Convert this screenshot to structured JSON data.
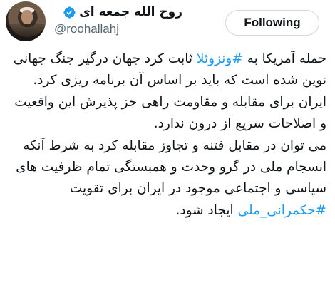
{
  "author": {
    "display_name": "روح الله جمعه ای",
    "handle": "@roohallahj",
    "verified_color": "#1d9bf0"
  },
  "follow_button": {
    "label": "Following"
  },
  "tweet": {
    "p1_pre": "حمله آمریکا به ",
    "p1_tag": "#ونزوئلا",
    "p1_post": " ثابت کرد جهان درگیر جنگ جهانی نوین شده است که باید بر اساس آن برنامه ریزی کرد.",
    "p2": "ایران برای مقابله و مقاومت راهی جز پذیرش این واقعیت و اصلاحات سریع از درون ندارد.",
    "p3_pre": "می توان در مقابل فتنه و تجاوز مقابله کرد به شرط آنکه انسجام ملی در گرو وحدت و همبستگی تمام ظرفیت های سیاسی و اجتماعی موجود در ایران برای تقویت ",
    "p3_tag": "#حکمرانی_ملی",
    "p3_post": " ایجاد شود."
  },
  "colors": {
    "hashtag": "#1d9bf0",
    "text": "#0f1419",
    "muted": "#536471"
  }
}
